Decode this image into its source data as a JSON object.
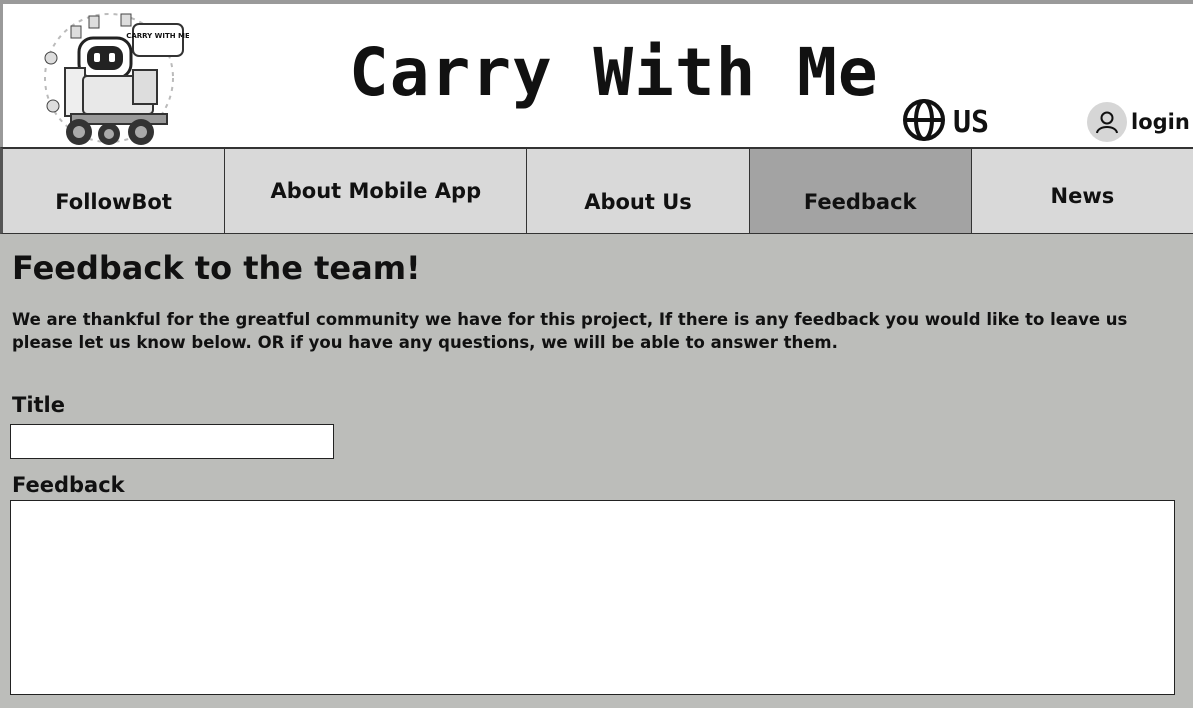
{
  "header": {
    "site_title": "Carry With Me",
    "logo_text": "CARRY WITH ME",
    "language": "US",
    "login_label": "login"
  },
  "nav": {
    "items": [
      {
        "label": "FollowBot"
      },
      {
        "label": "About Mobile App"
      },
      {
        "label": "About Us"
      },
      {
        "label": "Feedback",
        "active": true
      },
      {
        "label": "News"
      }
    ]
  },
  "main": {
    "heading": "Feedback to the team!",
    "intro": "We are thankful for the greatful community we have for this project, If there is any feedback you would like to leave us please let us know below. OR if you have any questions, we will be able to answer them.",
    "form": {
      "title_label": "Title",
      "title_value": "",
      "feedback_label": "Feedback",
      "feedback_value": ""
    }
  },
  "colors": {
    "page_bg": "#bcbdba",
    "nav_bg": "#d9d9d9",
    "nav_active_bg": "#a3a3a3",
    "header_bg": "#ffffff"
  }
}
